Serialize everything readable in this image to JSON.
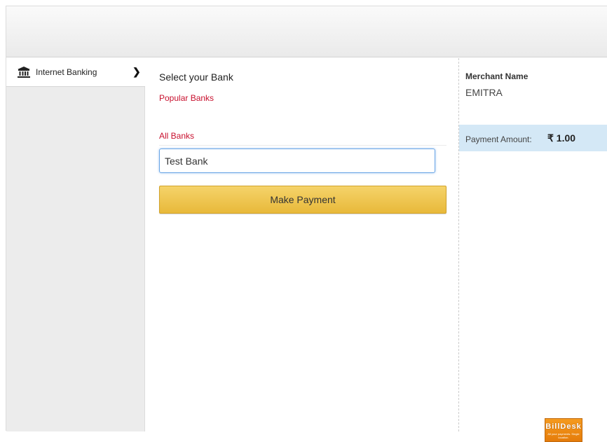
{
  "sidebar": {
    "tab_label": "Internet Banking",
    "tab_icon": "bank-icon",
    "chevron_glyph": "❯"
  },
  "main": {
    "title": "Select your Bank",
    "popular_label": "Popular Banks",
    "all_banks_label": "All Banks",
    "bank_input_value": "Test Bank",
    "pay_button_label": "Make Payment"
  },
  "summary": {
    "merchant_label": "Merchant Name",
    "merchant_value": "EMITRA",
    "amount_label": "Payment Amount:",
    "amount_value": "₹ 1.00"
  },
  "logo": {
    "name": "BillDesk",
    "tagline": "All your payments. Single location."
  },
  "colors": {
    "accent_red": "#c8102e",
    "button_gold": "#e8b93a",
    "amount_bar": "#d4e8f6",
    "input_focus": "#6aa6e6"
  }
}
